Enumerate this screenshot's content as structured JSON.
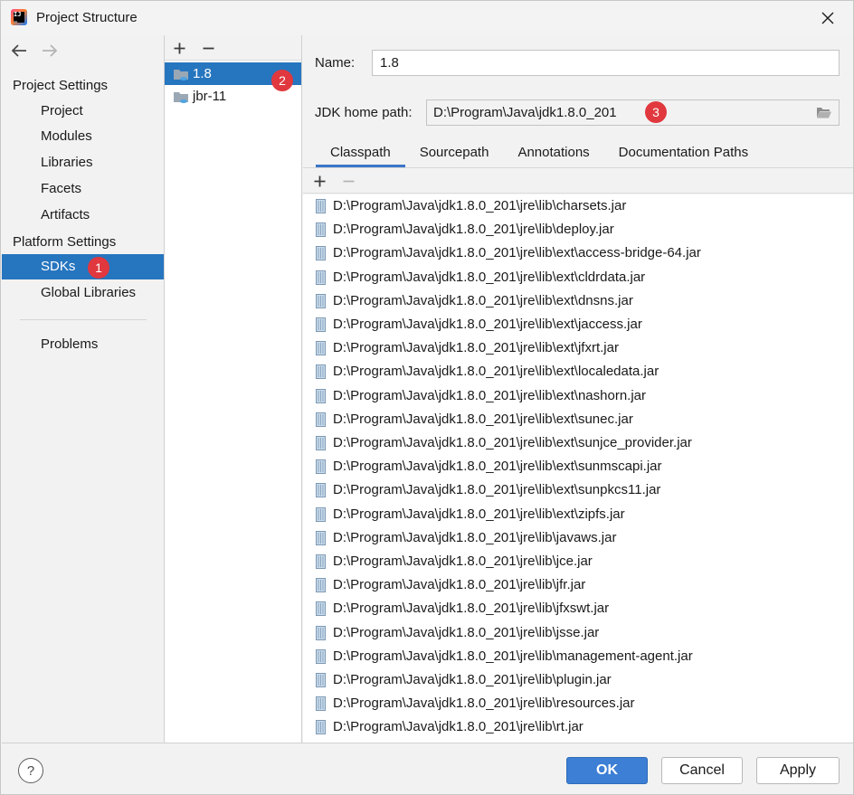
{
  "window": {
    "title": "Project Structure"
  },
  "left_panel": {
    "project_settings_header": "Project Settings",
    "project_settings_items": [
      "Project",
      "Modules",
      "Libraries",
      "Facets",
      "Artifacts"
    ],
    "platform_settings_header": "Platform Settings",
    "platform_settings_items": [
      "SDKs",
      "Global Libraries"
    ],
    "selected_item": "SDKs",
    "problems_label": "Problems",
    "badge": "1"
  },
  "sdk_list": {
    "items": [
      "1.8",
      "jbr-11"
    ],
    "selected": "1.8",
    "badge": "2"
  },
  "sdk_detail": {
    "name_label": "Name:",
    "name_value": "1.8",
    "home_path_label": "JDK home path:",
    "home_path_value": "D:\\Program\\Java\\jdk1.8.0_201",
    "badge": "3",
    "tabs": [
      "Classpath",
      "Sourcepath",
      "Annotations",
      "Documentation Paths"
    ],
    "active_tab": "Classpath",
    "classpath": [
      "D:\\Program\\Java\\jdk1.8.0_201\\jre\\lib\\charsets.jar",
      "D:\\Program\\Java\\jdk1.8.0_201\\jre\\lib\\deploy.jar",
      "D:\\Program\\Java\\jdk1.8.0_201\\jre\\lib\\ext\\access-bridge-64.jar",
      "D:\\Program\\Java\\jdk1.8.0_201\\jre\\lib\\ext\\cldrdata.jar",
      "D:\\Program\\Java\\jdk1.8.0_201\\jre\\lib\\ext\\dnsns.jar",
      "D:\\Program\\Java\\jdk1.8.0_201\\jre\\lib\\ext\\jaccess.jar",
      "D:\\Program\\Java\\jdk1.8.0_201\\jre\\lib\\ext\\jfxrt.jar",
      "D:\\Program\\Java\\jdk1.8.0_201\\jre\\lib\\ext\\localedata.jar",
      "D:\\Program\\Java\\jdk1.8.0_201\\jre\\lib\\ext\\nashorn.jar",
      "D:\\Program\\Java\\jdk1.8.0_201\\jre\\lib\\ext\\sunec.jar",
      "D:\\Program\\Java\\jdk1.8.0_201\\jre\\lib\\ext\\sunjce_provider.jar",
      "D:\\Program\\Java\\jdk1.8.0_201\\jre\\lib\\ext\\sunmscapi.jar",
      "D:\\Program\\Java\\jdk1.8.0_201\\jre\\lib\\ext\\sunpkcs11.jar",
      "D:\\Program\\Java\\jdk1.8.0_201\\jre\\lib\\ext\\zipfs.jar",
      "D:\\Program\\Java\\jdk1.8.0_201\\jre\\lib\\javaws.jar",
      "D:\\Program\\Java\\jdk1.8.0_201\\jre\\lib\\jce.jar",
      "D:\\Program\\Java\\jdk1.8.0_201\\jre\\lib\\jfr.jar",
      "D:\\Program\\Java\\jdk1.8.0_201\\jre\\lib\\jfxswt.jar",
      "D:\\Program\\Java\\jdk1.8.0_201\\jre\\lib\\jsse.jar",
      "D:\\Program\\Java\\jdk1.8.0_201\\jre\\lib\\management-agent.jar",
      "D:\\Program\\Java\\jdk1.8.0_201\\jre\\lib\\plugin.jar",
      "D:\\Program\\Java\\jdk1.8.0_201\\jre\\lib\\resources.jar",
      "D:\\Program\\Java\\jdk1.8.0_201\\jre\\lib\\rt.jar"
    ]
  },
  "footer": {
    "help_label": "?",
    "ok_label": "OK",
    "cancel_label": "Cancel",
    "apply_label": "Apply"
  },
  "icons": {
    "app": "intellij-idea-icon",
    "close": "close-icon",
    "back": "arrow-left-icon",
    "forward": "arrow-right-icon",
    "add": "plus-icon",
    "remove": "minus-icon",
    "sdk": "jdk-folder-icon",
    "browse": "folder-open-icon",
    "jar": "jar-file-icon"
  },
  "colors": {
    "selection": "#2675bf",
    "badge": "#e0383e",
    "primary_button": "#3c7fd4",
    "active_tab_underline": "#3a76c8"
  }
}
